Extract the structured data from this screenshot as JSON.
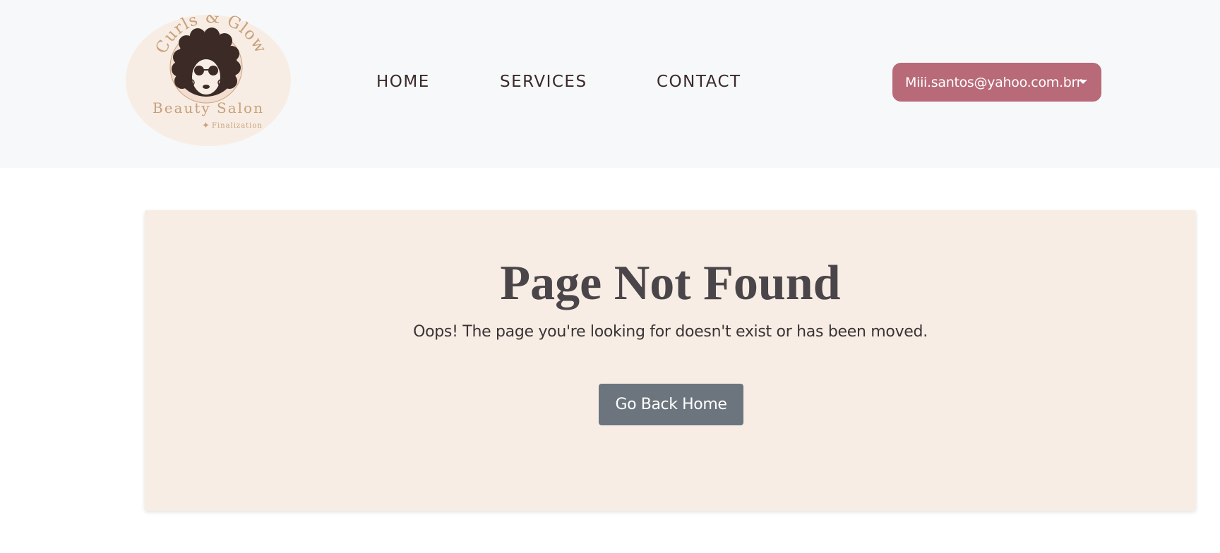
{
  "brand": {
    "name_top": "Curls & Glow",
    "name_bottom": "Beauty Salon",
    "tagline": "Finalization",
    "colors": {
      "badge_bg": "#f7ede4",
      "accent": "#c9a07a",
      "hair": "#3b2a26"
    }
  },
  "nav": {
    "items": [
      {
        "label": "HOME"
      },
      {
        "label": "SERVICES"
      },
      {
        "label": "CONTACT"
      }
    ]
  },
  "user_menu": {
    "email": "Miii.santos@yahoo.com.brr",
    "icon": "caret-down-icon",
    "color": "#b86a78"
  },
  "error": {
    "title": "Page Not Found",
    "message": "Oops! The page you're looking for doesn't exist or has been moved.",
    "button_label": "Go Back Home",
    "button_color": "#6c757d",
    "card_bg": "#f7ede4"
  }
}
